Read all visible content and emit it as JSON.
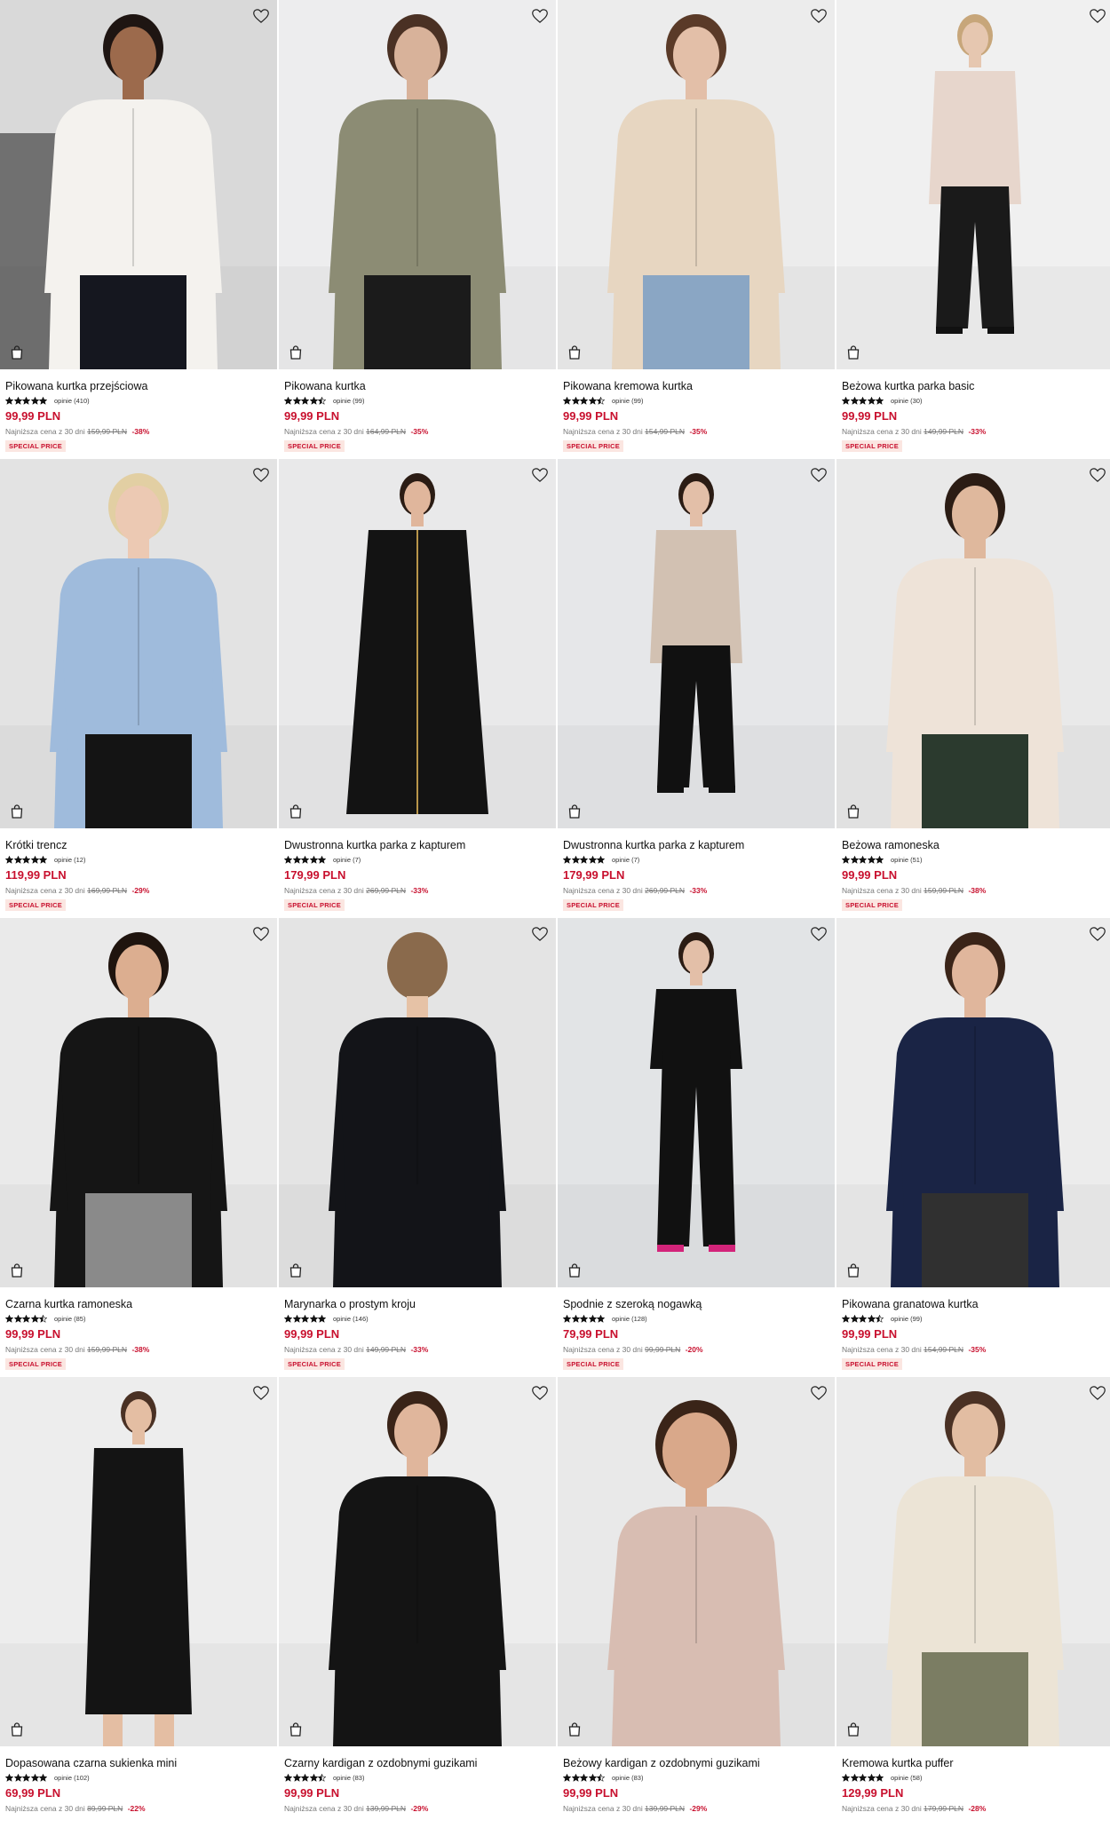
{
  "products": [
    {
      "name": "Pikowana kurtka przejściowa",
      "reviews": "opinie (410)",
      "rating": 5,
      "price": "99,99 PLN",
      "lowest_text": "Najniższa cena z 30 dni",
      "old_price": "159,99 PLN",
      "discount": "-38%",
      "badge": "SPECIAL PRICE",
      "bg": "#d9d9d9",
      "garment": "#f4f2ee",
      "skin": "#9c6a4c",
      "hair": "#1e1512",
      "pants": "#15171f",
      "pose": "seated"
    },
    {
      "name": "Pikowana kurtka",
      "reviews": "opinie (99)",
      "rating": 4.5,
      "price": "99,99 PLN",
      "lowest_text": "Najniższa cena z 30 dni",
      "old_price": "164,99 PLN",
      "discount": "-35%",
      "badge": "SPECIAL PRICE",
      "bg": "#ededee",
      "garment": "#8c8c74",
      "skin": "#d8b29a",
      "hair": "#4a3124",
      "pants": "#1b1b1b",
      "pose": "half"
    },
    {
      "name": "Pikowana kremowa kurtka",
      "reviews": "opinie (99)",
      "rating": 4.5,
      "price": "99,99 PLN",
      "lowest_text": "Najniższa cena z 30 dni",
      "old_price": "154,99 PLN",
      "discount": "-35%",
      "badge": "SPECIAL PRICE",
      "bg": "#ececec",
      "garment": "#e7d6c1",
      "skin": "#e3bfa8",
      "hair": "#5a3a28",
      "pants": "#8aa6c4",
      "pose": "half"
    },
    {
      "name": "Beżowa kurtka parka basic",
      "reviews": "opinie (30)",
      "rating": 5,
      "price": "99,99 PLN",
      "lowest_text": "Najniższa cena z 30 dni",
      "old_price": "149,99 PLN",
      "discount": "-33%",
      "badge": "SPECIAL PRICE",
      "bg": "#f0f0f0",
      "garment": "#e7d6cc",
      "skin": "#e6c7b0",
      "hair": "#c7a67a",
      "pants": "#1a1a1a",
      "pose": "full"
    },
    {
      "name": "Krótki trencz",
      "reviews": "opinie (12)",
      "rating": 5,
      "price": "119,99 PLN",
      "lowest_text": "Najniższa cena z 30 dni",
      "old_price": "169,99 PLN",
      "discount": "-29%",
      "badge": "SPECIAL PRICE",
      "bg": "#e3e3e3",
      "garment": "#9fbbdc",
      "skin": "#ecc9b3",
      "hair": "#e2cfa3",
      "pants": "#141414",
      "pose": "half"
    },
    {
      "name": "Dwustronna kurtka parka z kapturem",
      "reviews": "opinie (7)",
      "rating": 5,
      "price": "179,99 PLN",
      "lowest_text": "Najniższa cena z 30 dni",
      "old_price": "269,99 PLN",
      "discount": "-33%",
      "badge": "SPECIAL PRICE",
      "bg": "#e9e9ea",
      "garment": "#131313",
      "skin": "#e0b69c",
      "hair": "#2b1c14",
      "pants": "#131313",
      "pose": "coat"
    },
    {
      "name": "Dwustronna kurtka parka z kapturem",
      "reviews": "opinie (7)",
      "rating": 5,
      "price": "179,99 PLN",
      "lowest_text": "Najniższa cena z 30 dni",
      "old_price": "269,99 PLN",
      "discount": "-33%",
      "badge": "SPECIAL PRICE",
      "bg": "#e6e7e9",
      "garment": "#d2c1b2",
      "skin": "#e3bfa8",
      "hair": "#2b1c14",
      "pants": "#111111",
      "pose": "full"
    },
    {
      "name": "Beżowa ramoneska",
      "reviews": "opinie (51)",
      "rating": 5,
      "price": "99,99 PLN",
      "lowest_text": "Najniższa cena z 30 dni",
      "old_price": "159,99 PLN",
      "discount": "-38%",
      "badge": "SPECIAL PRICE",
      "bg": "#e9e9e9",
      "garment": "#eee3d8",
      "skin": "#dfb89d",
      "hair": "#2b1c14",
      "pants": "#2b3a2e",
      "pose": "half"
    },
    {
      "name": "Czarna kurtka ramoneska",
      "reviews": "opinie (85)",
      "rating": 4.5,
      "price": "99,99 PLN",
      "lowest_text": "Najniższa cena z 30 dni",
      "old_price": "159,99 PLN",
      "discount": "-38%",
      "badge": "SPECIAL PRICE",
      "bg": "#eaeaea",
      "garment": "#151515",
      "skin": "#dcae90",
      "hair": "#1f140e",
      "pants": "#8a8a8a",
      "pose": "half"
    },
    {
      "name": "Marynarka o prostym kroju",
      "reviews": "opinie (146)",
      "rating": 5,
      "price": "99,99 PLN",
      "lowest_text": "Najniższa cena z 30 dni",
      "old_price": "149,99 PLN",
      "discount": "-33%",
      "badge": "SPECIAL PRICE",
      "bg": "#e4e4e4",
      "garment": "#131418",
      "skin": "#e6c2a6",
      "hair": "#8a6a4c",
      "pants": "#131418",
      "pose": "back"
    },
    {
      "name": "Spodnie z szeroką nogawką",
      "reviews": "opinie (128)",
      "rating": 5,
      "price": "79,99 PLN",
      "lowest_text": "Najniższa cena z 30 dni",
      "old_price": "99,99 PLN",
      "discount": "-20%",
      "badge": "SPECIAL PRICE",
      "bg": "#e2e4e6",
      "garment": "#111111",
      "skin": "#e3bfa8",
      "hair": "#2b1c14",
      "pants": "#111111",
      "pose": "walk"
    },
    {
      "name": "Pikowana granatowa kurtka",
      "reviews": "opinie (99)",
      "rating": 4.5,
      "price": "99,99 PLN",
      "lowest_text": "Najniższa cena z 30 dni",
      "old_price": "154,99 PLN",
      "discount": "-35%",
      "badge": "SPECIAL PRICE",
      "bg": "#ececec",
      "garment": "#1a2445",
      "skin": "#e0b69c",
      "hair": "#3a2418",
      "pants": "#303030",
      "pose": "half"
    },
    {
      "name": "Dopasowana czarna sukienka mini",
      "reviews": "opinie (102)",
      "rating": 5,
      "price": "69,99 PLN",
      "lowest_text": "Najniższa cena z 30 dni",
      "old_price": "89,99 PLN",
      "discount": "-22%",
      "badge": "",
      "bg": "#ededed",
      "garment": "#141414",
      "skin": "#e4bea3",
      "hair": "#4a3124",
      "pants": "#141414",
      "pose": "dress"
    },
    {
      "name": "Czarny kardigan z ozdobnymi guzikami",
      "reviews": "opinie (83)",
      "rating": 4.5,
      "price": "99,99 PLN",
      "lowest_text": "Najniższa cena z 30 dni",
      "old_price": "139,99 PLN",
      "discount": "-29%",
      "badge": "",
      "bg": "#ededed",
      "garment": "#141414",
      "skin": "#e0b69c",
      "hair": "#3a2418",
      "pants": "#141414",
      "pose": "half"
    },
    {
      "name": "Beżowy kardigan z ozdobnymi guzikami",
      "reviews": "opinie (83)",
      "rating": 4.5,
      "price": "99,99 PLN",
      "lowest_text": "Najniższa cena z 30 dni",
      "old_price": "139,99 PLN",
      "discount": "-29%",
      "badge": "",
      "bg": "#e9e9e9",
      "garment": "#d8bdb2",
      "skin": "#d9a88a",
      "hair": "#3a2418",
      "pants": "#d8bdb2",
      "pose": "close"
    },
    {
      "name": "Kremowa kurtka puffer",
      "reviews": "opinie (58)",
      "rating": 5,
      "price": "129,99 PLN",
      "lowest_text": "Najniższa cena z 30 dni",
      "old_price": "179,99 PLN",
      "discount": "-28%",
      "badge": "",
      "bg": "#ebebeb",
      "garment": "#ece4d6",
      "skin": "#e2bda2",
      "hair": "#4a3124",
      "pants": "#7b7d63",
      "pose": "half"
    }
  ],
  "icons": {
    "wishlist": "heart-outline-icon",
    "add_to_bag": "shopping-bag-icon",
    "star": "star-icon"
  }
}
